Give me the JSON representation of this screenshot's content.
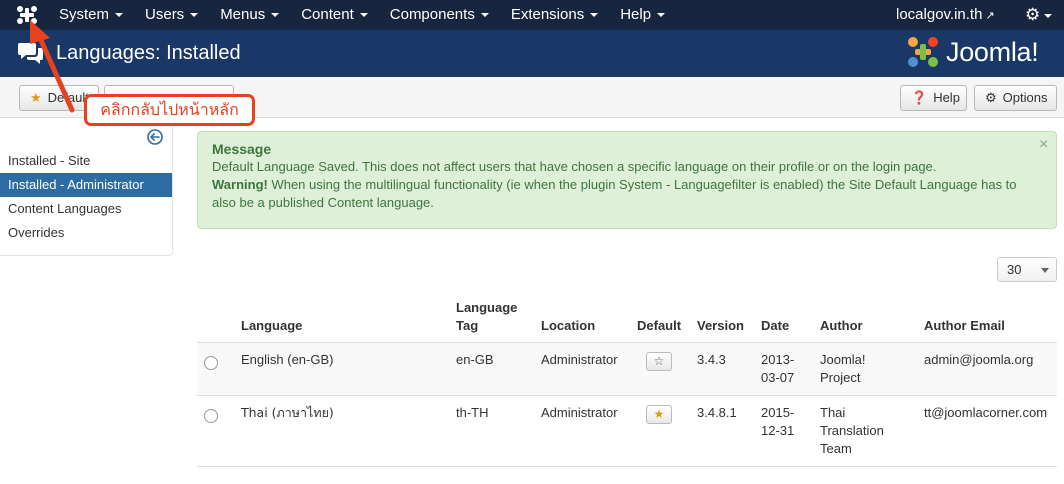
{
  "navbar": {
    "logo_icon": "joomla-logo-icon",
    "menu": [
      {
        "label": "System"
      },
      {
        "label": "Users"
      },
      {
        "label": "Menus"
      },
      {
        "label": "Content"
      },
      {
        "label": "Components"
      },
      {
        "label": "Extensions"
      },
      {
        "label": "Help"
      }
    ],
    "site_link": "localgov.in.th",
    "site_link_icon": "external-link-icon",
    "settings_icon": "gear-icon"
  },
  "header": {
    "title": "Languages: Installed",
    "brand_text": "Joomla!",
    "title_icon": "comments-icon"
  },
  "toolbar": {
    "default_label": "Default",
    "default_icon": "star-icon",
    "help_label": "Help",
    "help_icon": "question-icon",
    "options_label": "Options",
    "options_icon": "gear-icon"
  },
  "annotation": {
    "text": "คลิกกลับไปหน้าหลัก",
    "color": "#e8411e"
  },
  "sidebar": {
    "items": [
      {
        "label": "Installed - Site",
        "active": false
      },
      {
        "label": "Installed - Administrator",
        "active": true
      },
      {
        "label": "Content Languages",
        "active": false
      },
      {
        "label": "Overrides",
        "active": false
      }
    ]
  },
  "message": {
    "heading": "Message",
    "line1": "Default Language Saved. This does not affect users that have chosen a specific language on their profile or on the login page.",
    "warning_label": "Warning!",
    "warning_text": " When using the multilingual functionality (ie when the plugin System - Languagefilter is enabled) the Site Default Language has to also be a published Content language.",
    "close_symbol": "×"
  },
  "list": {
    "limit": "30",
    "columns": {
      "language": "Language",
      "tag_line1": "Language",
      "tag_line2": "Tag",
      "location": "Location",
      "default": "Default",
      "version": "Version",
      "date": "Date",
      "author": "Author",
      "email": "Author Email"
    },
    "rows": [
      {
        "language": "English (en-GB)",
        "tag": "en-GB",
        "location": "Administrator",
        "is_default": false,
        "version": "3.4.3",
        "date_line1": "2013-",
        "date_line2": "03-07",
        "author_line1": "Joomla!",
        "author_line2": "Project",
        "author_line3": "",
        "email": "admin@joomla.org"
      },
      {
        "language": "Thai (ภาษาไทย)",
        "tag": "th-TH",
        "location": "Administrator",
        "is_default": true,
        "version": "3.4.8.1",
        "date_line1": "2015-",
        "date_line2": "12-31",
        "author_line1": "Thai",
        "author_line2": "Translation",
        "author_line3": "Team",
        "email": "tt@joomlacorner.com"
      }
    ]
  },
  "colors": {
    "navbar_bg": "#17253f",
    "header_bg": "#1a3867",
    "active_item": "#2d6ca2",
    "alert_bg": "#dff0d8",
    "star": "#e09a19"
  }
}
